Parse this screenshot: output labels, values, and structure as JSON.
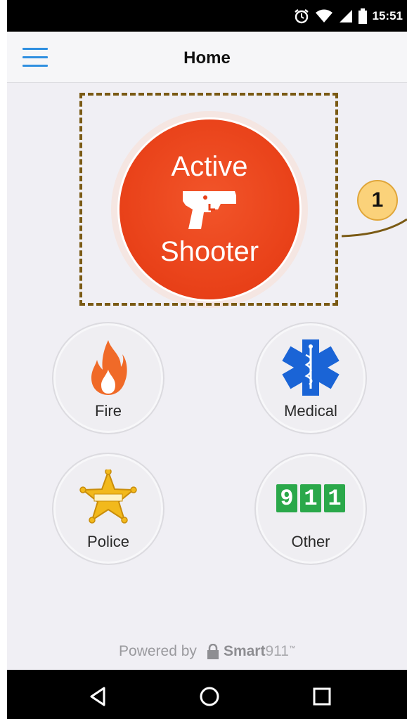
{
  "status_bar": {
    "time": "15:51",
    "icons": [
      "alarm-icon",
      "wifi-icon",
      "signal-icon",
      "battery-icon"
    ]
  },
  "app_bar": {
    "title": "Home",
    "menu_icon": "hamburger-menu-icon"
  },
  "annotation": {
    "callout_number": "1"
  },
  "main_button": {
    "line1": "Active",
    "line2": "Shooter",
    "icon": "handgun-icon",
    "color": "#e84018"
  },
  "categories": [
    {
      "label": "Fire",
      "icon": "flame-icon"
    },
    {
      "label": "Medical",
      "icon": "star-of-life-icon"
    },
    {
      "label": "Police",
      "icon": "police-badge-icon"
    },
    {
      "label": "Other",
      "icon": "911-icon",
      "digits": [
        "9",
        "1",
        "1"
      ]
    }
  ],
  "footer": {
    "powered_by": "Powered by",
    "brand": "Smart",
    "brand_number": "911",
    "brand_mark": "™"
  },
  "nav_bar": {
    "icons": [
      "back-icon",
      "home-icon",
      "recents-icon"
    ]
  },
  "colors": {
    "accent_blue": "#2f8fe0",
    "shooter_red": "#e84018",
    "annotation_brown": "#7a5a14",
    "callout_yellow": "#fbd27a",
    "green_911": "#2aa84a"
  }
}
